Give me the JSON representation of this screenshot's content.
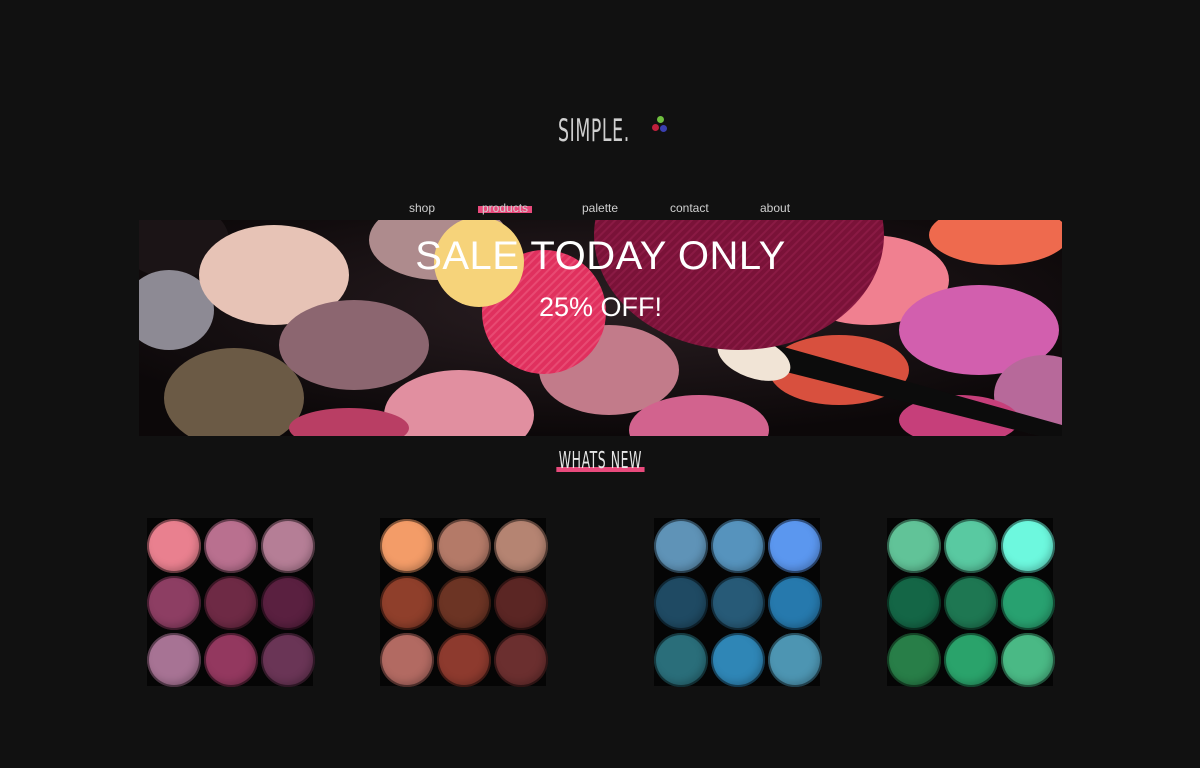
{
  "logo": {
    "text": "SIMPLE."
  },
  "nav": {
    "items": [
      {
        "label": "shop",
        "active": false
      },
      {
        "label": "products",
        "active": true
      },
      {
        "label": "palette",
        "active": false
      },
      {
        "label": "contact",
        "active": false
      },
      {
        "label": "about",
        "active": false
      }
    ]
  },
  "banner": {
    "title": "SALE TODAY ONLY",
    "subtitle": "25% OFF!"
  },
  "section": {
    "heading": "WHATS NEW"
  },
  "colors": {
    "accent": "#e84a7c",
    "background": "#111111"
  },
  "palettes": [
    {
      "name": "pinks",
      "swatches": [
        "#e9808f",
        "#b9708f",
        "#b57e96",
        "#8d3e63",
        "#6e2a45",
        "#5a2040",
        "#a77394",
        "#93385f",
        "#6a3556"
      ]
    },
    {
      "name": "browns",
      "swatches": [
        "#f39c68",
        "#b47a68",
        "#b58472",
        "#8f3f2b",
        "#6c3424",
        "#5b2624",
        "#b26a62",
        "#8d3a2e",
        "#6b2f2f"
      ]
    },
    {
      "name": "blues",
      "swatches": [
        "#5f93b7",
        "#5693bd",
        "#5b97ef",
        "#1f4a63",
        "#275a77",
        "#2679ad",
        "#2a6e7a",
        "#2f86b6",
        "#4d95b2"
      ]
    },
    {
      "name": "greens",
      "swatches": [
        "#61c398",
        "#59c9a1",
        "#6df8de",
        "#146646",
        "#1e7752",
        "#28a170",
        "#287e48",
        "#2aa36b",
        "#4ab985"
      ]
    }
  ]
}
